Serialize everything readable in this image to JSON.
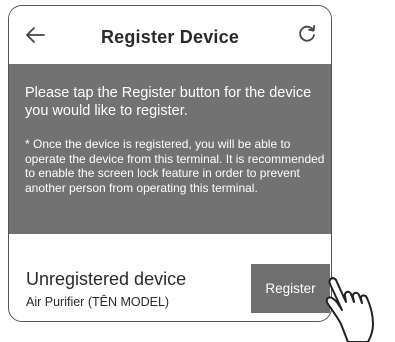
{
  "header": {
    "back_icon": "arrow-left-icon",
    "title": "Register Device",
    "refresh_icon": "refresh-icon"
  },
  "info": {
    "main_text": "Please tap the Register button for the device you would like to register.",
    "note_text": "* Once the device is registered, you will be able to operate the device from this terminal. It is recommended to enable the screen lock feature in order to prevent another person from operating this terminal."
  },
  "device": {
    "status_label": "Unregistered device",
    "type": "Air Purifier",
    "model": "(TÊN MODEL)",
    "register_label": "Register"
  },
  "colors": {
    "panel": "#727272",
    "button": "#6f6f6f"
  }
}
